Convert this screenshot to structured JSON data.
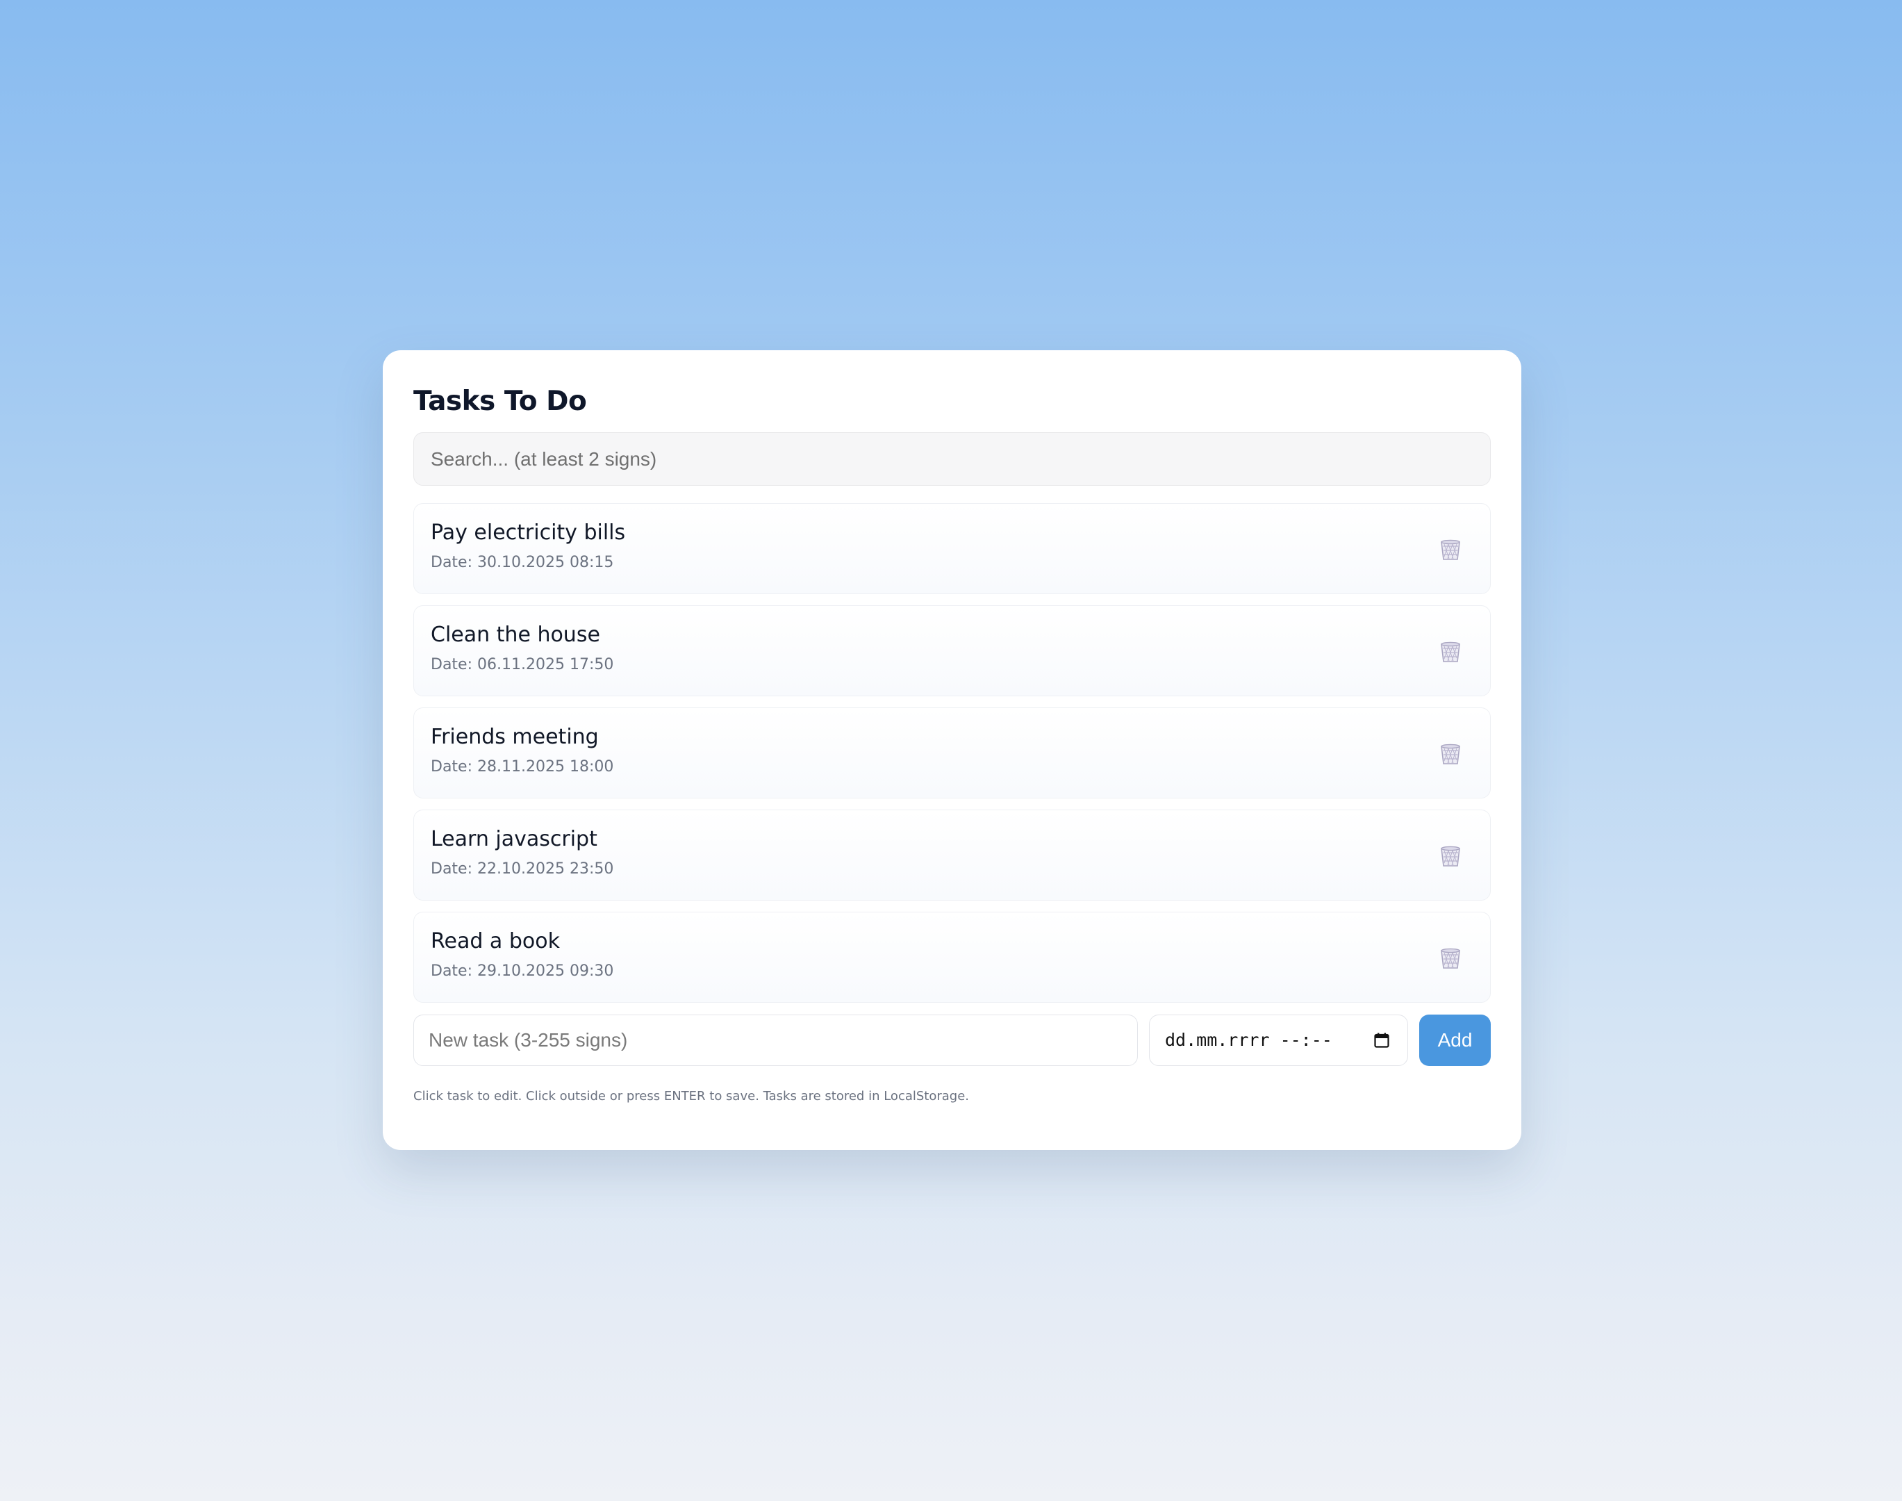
{
  "app": {
    "title": "Tasks To Do"
  },
  "search": {
    "placeholder": "Search... (at least 2 signs)",
    "value": ""
  },
  "tasks": [
    {
      "title": "Pay electricity bills",
      "date": "Date: 30.10.2025 08:15"
    },
    {
      "title": "Clean the house",
      "date": "Date: 06.11.2025 17:50"
    },
    {
      "title": "Friends meeting",
      "date": "Date: 28.11.2025 18:00"
    },
    {
      "title": "Learn javascript",
      "date": "Date: 22.10.2025 23:50"
    },
    {
      "title": "Read a book",
      "date": "Date: 29.10.2025 09:30"
    }
  ],
  "delete_icon": "trash-bin-icon",
  "new_task": {
    "placeholder": "New task (3-255 signs)",
    "value": ""
  },
  "date_input": {
    "placeholder_text": "dd.mm.rrrr --:--",
    "icon": "calendar-icon"
  },
  "add_button": {
    "label": "Add"
  },
  "hint": "Click task to edit. Click outside or press ENTER to save. Tasks are stored in LocalStorage.",
  "colors": {
    "accent": "#4a97df",
    "title_text": "#0f172a",
    "muted_text": "#6b7280",
    "trash_icon": "#b7b3cc"
  }
}
